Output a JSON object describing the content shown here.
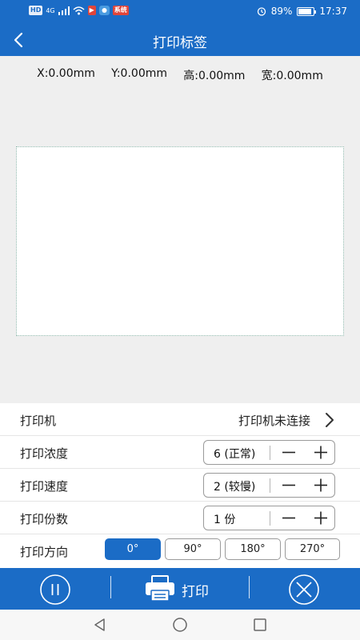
{
  "status_bar": {
    "left_chips": [
      "HD",
      "4G"
    ],
    "app_chips": [
      "▶",
      "系统"
    ],
    "battery_text": "89%",
    "battery_level": 0.89,
    "time": "17:37"
  },
  "header": {
    "title": "打印标签"
  },
  "coords": {
    "x": "X:0.00mm",
    "y": "Y:0.00mm",
    "height": "高:0.00mm",
    "width": "宽:0.00mm"
  },
  "settings": {
    "printer": {
      "label": "打印机",
      "value": "打印机未连接"
    },
    "density": {
      "label": "打印浓度",
      "value": "6 (正常)"
    },
    "speed": {
      "label": "打印速度",
      "value": "2 (较慢)"
    },
    "copies": {
      "label": "打印份数",
      "value": "1 份"
    },
    "orientation": {
      "label": "打印方向",
      "options": [
        "0°",
        "90°",
        "180°",
        "270°"
      ],
      "selected": "0°"
    }
  },
  "actions": {
    "print_label": "打印"
  },
  "colors": {
    "brand": "#1b6cc6",
    "workarea": "#efefef"
  },
  "icons": {
    "back": "chevron-left-icon",
    "pause": "pause-icon",
    "print": "printer-icon",
    "cancel": "close-circle-icon"
  }
}
